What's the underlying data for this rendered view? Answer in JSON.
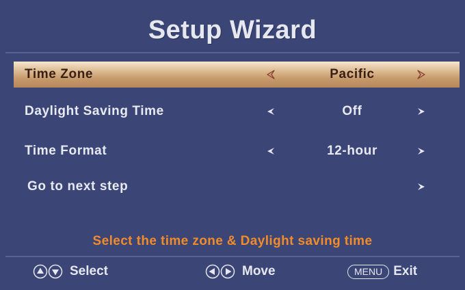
{
  "title": "Setup Wizard",
  "menu": {
    "items": [
      {
        "label": "Time Zone",
        "value": "Pacific",
        "has_left_arrow": true,
        "has_right_arrow": true,
        "selected": true
      },
      {
        "label": "Daylight Saving Time",
        "value": "Off",
        "has_left_arrow": true,
        "has_right_arrow": true,
        "selected": false
      },
      {
        "label": "Time Format",
        "value": "12-hour",
        "has_left_arrow": true,
        "has_right_arrow": true,
        "selected": false
      },
      {
        "label": "Go to next step",
        "value": "",
        "has_left_arrow": false,
        "has_right_arrow": true,
        "selected": false
      }
    ]
  },
  "message": "Select the time zone & Daylight saving time",
  "footer": {
    "select_label": "Select",
    "move_label": "Move",
    "menu_key": "MENU",
    "exit_label": "Exit"
  },
  "colors": {
    "background": "#3b4576",
    "highlight": "#d2ad82",
    "message": "#f28b2a",
    "text": "#e8eaf2"
  }
}
